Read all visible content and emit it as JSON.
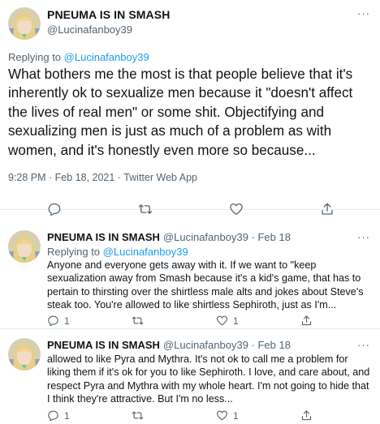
{
  "main_tweet": {
    "display_name": "PNEUMA IS IN SMASH",
    "handle": "@Lucinafanboy39",
    "replying_prefix": "Replying to",
    "replying_to": "@Lucinafanboy39",
    "text": "What bothers me the most is that people believe that it's inherently ok to sexualize men because it \"doesn't affect the lives of real men\" or some shit. Objectifying and sexualizing men is just as much of a problem as with women, and it's honestly even more so because...",
    "meta": "9:28 PM · Feb 18, 2021 · Twitter Web App",
    "more_icon": "···"
  },
  "replies": [
    {
      "display_name": "PNEUMA IS IN SMASH",
      "handle_date": "@Lucinafanboy39 · Feb 18",
      "replying_prefix": "Replying to",
      "replying_to": "@Lucinafanboy39",
      "text": "Anyone and everyone gets away with it. If we want to \"keep sexualization away from Smash because it's a kid's game, that has to pertain to thirsting over the shirtless male alts and jokes about Steve's steak too. You're allowed to like shirtless Sephiroth, just as I'm...",
      "reply_count": "1",
      "like_count": "1",
      "more_icon": "···"
    },
    {
      "display_name": "PNEUMA IS IN SMASH",
      "handle_date": "@Lucinafanboy39 · Feb 18",
      "text": "allowed to like Pyra and Mythra. It's not ok to call me a problem for liking them if it's ok for you to like Sephiroth. I love, and care about, and respect Pyra and Mythra with my whole heart. I'm not going to hide that I think they're attractive. But I'm no less...",
      "reply_count": "1",
      "like_count": "1",
      "more_icon": "···"
    }
  ],
  "icons": {
    "reply": "reply-icon",
    "retweet": "retweet-icon",
    "like": "heart-icon",
    "share": "share-icon"
  },
  "colors": {
    "link": "#1d9bf0",
    "secondary_text": "#536471",
    "primary_text": "#0f1419",
    "divider": "#e6ecf0"
  }
}
